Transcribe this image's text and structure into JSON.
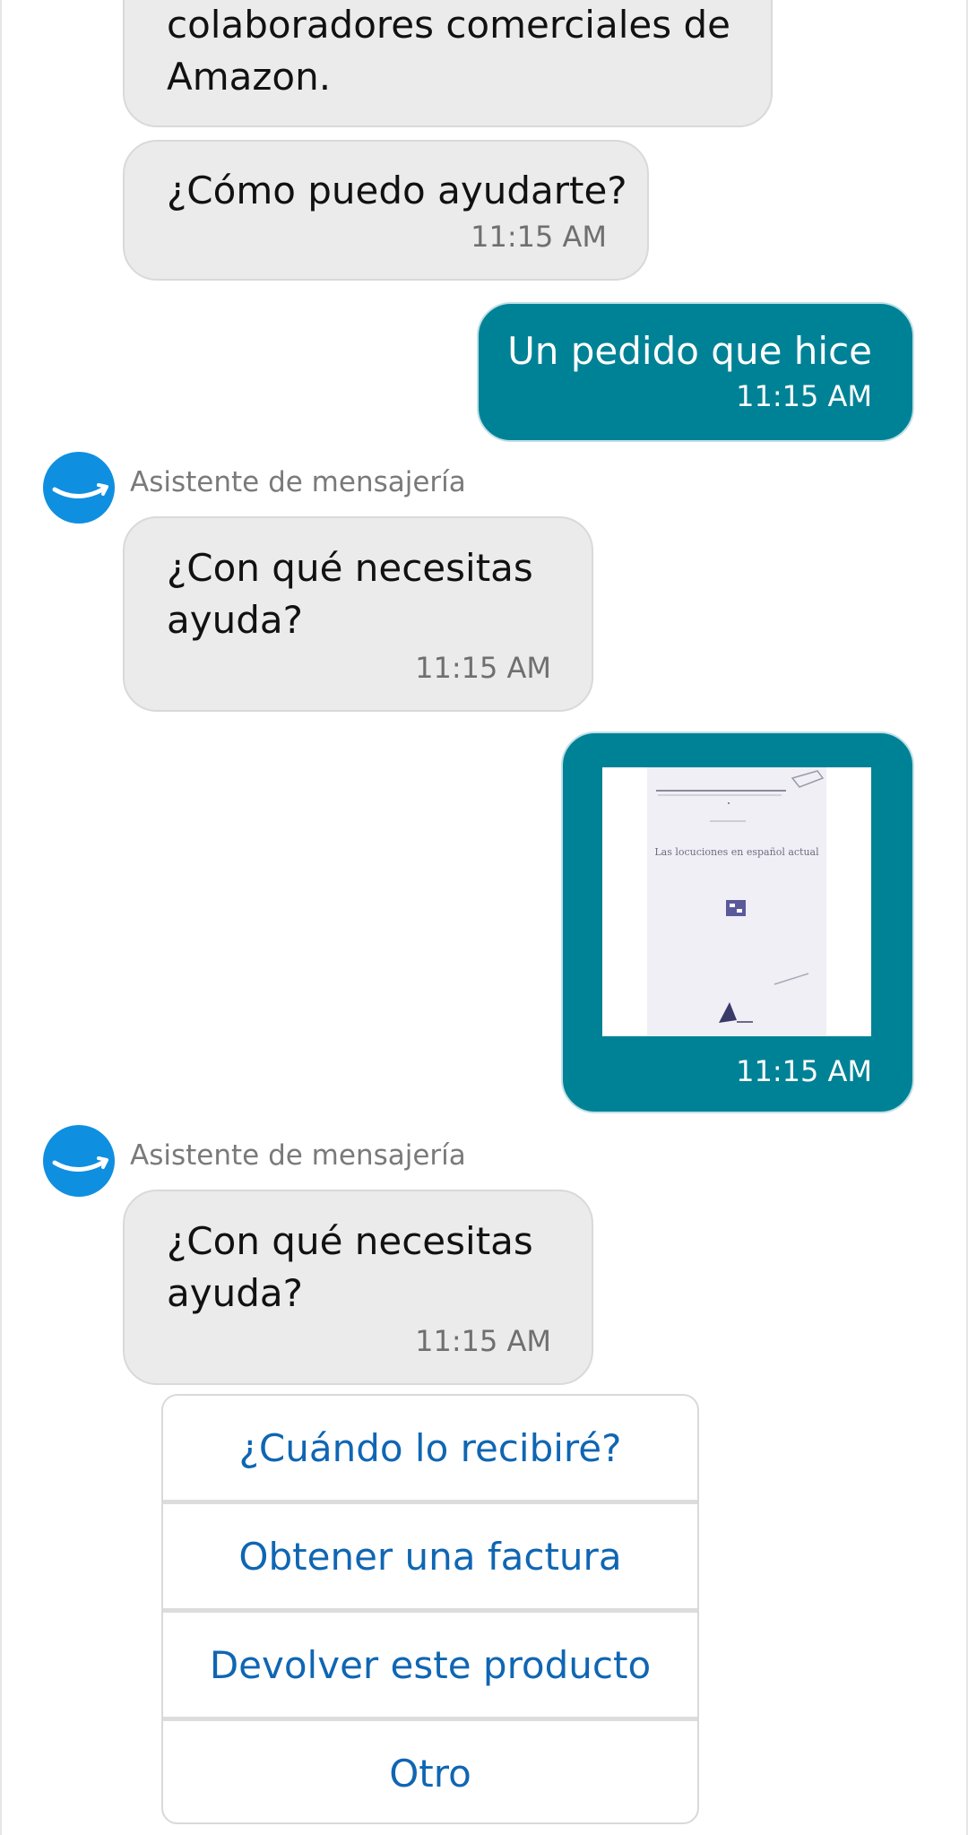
{
  "messages": [
    {
      "id": "m1",
      "direction": "incoming",
      "lines": [
        "colaboradores comerciales de",
        "Amazon."
      ],
      "time": ""
    },
    {
      "id": "m2",
      "direction": "incoming",
      "lines": [
        "¿Cómo puedo ayudarte?"
      ],
      "time": "11:15 AM"
    },
    {
      "id": "m3",
      "direction": "outgoing",
      "lines": [
        "Un pedido que hice"
      ],
      "time": "11:15 AM"
    },
    {
      "id": "m4",
      "direction": "incoming",
      "sender": "Asistente de mensajería",
      "lines": [
        "¿Con qué necesitas",
        "ayuda?"
      ],
      "time": "11:15 AM"
    },
    {
      "id": "m5",
      "direction": "outgoing",
      "attachment": {
        "kind": "book-cover",
        "cover_text": "Las locuciones en español actual"
      },
      "time": "11:15 AM"
    },
    {
      "id": "m6",
      "direction": "incoming",
      "sender": "Asistente de mensajería",
      "lines": [
        "¿Con qué necesitas",
        "ayuda?"
      ],
      "time": "11:15 AM"
    }
  ],
  "quick_replies": [
    "¿Cuándo lo recibiré?",
    "Obtener una factura",
    "Devolver este producto",
    "Otro"
  ],
  "avatar_icon": "amazon-smile-icon",
  "colors": {
    "outgoing_bubble": "#008296",
    "incoming_bubble": "#ebebeb",
    "avatar": "#0f8fe0",
    "quick_reply_text": "#0f66b3"
  }
}
